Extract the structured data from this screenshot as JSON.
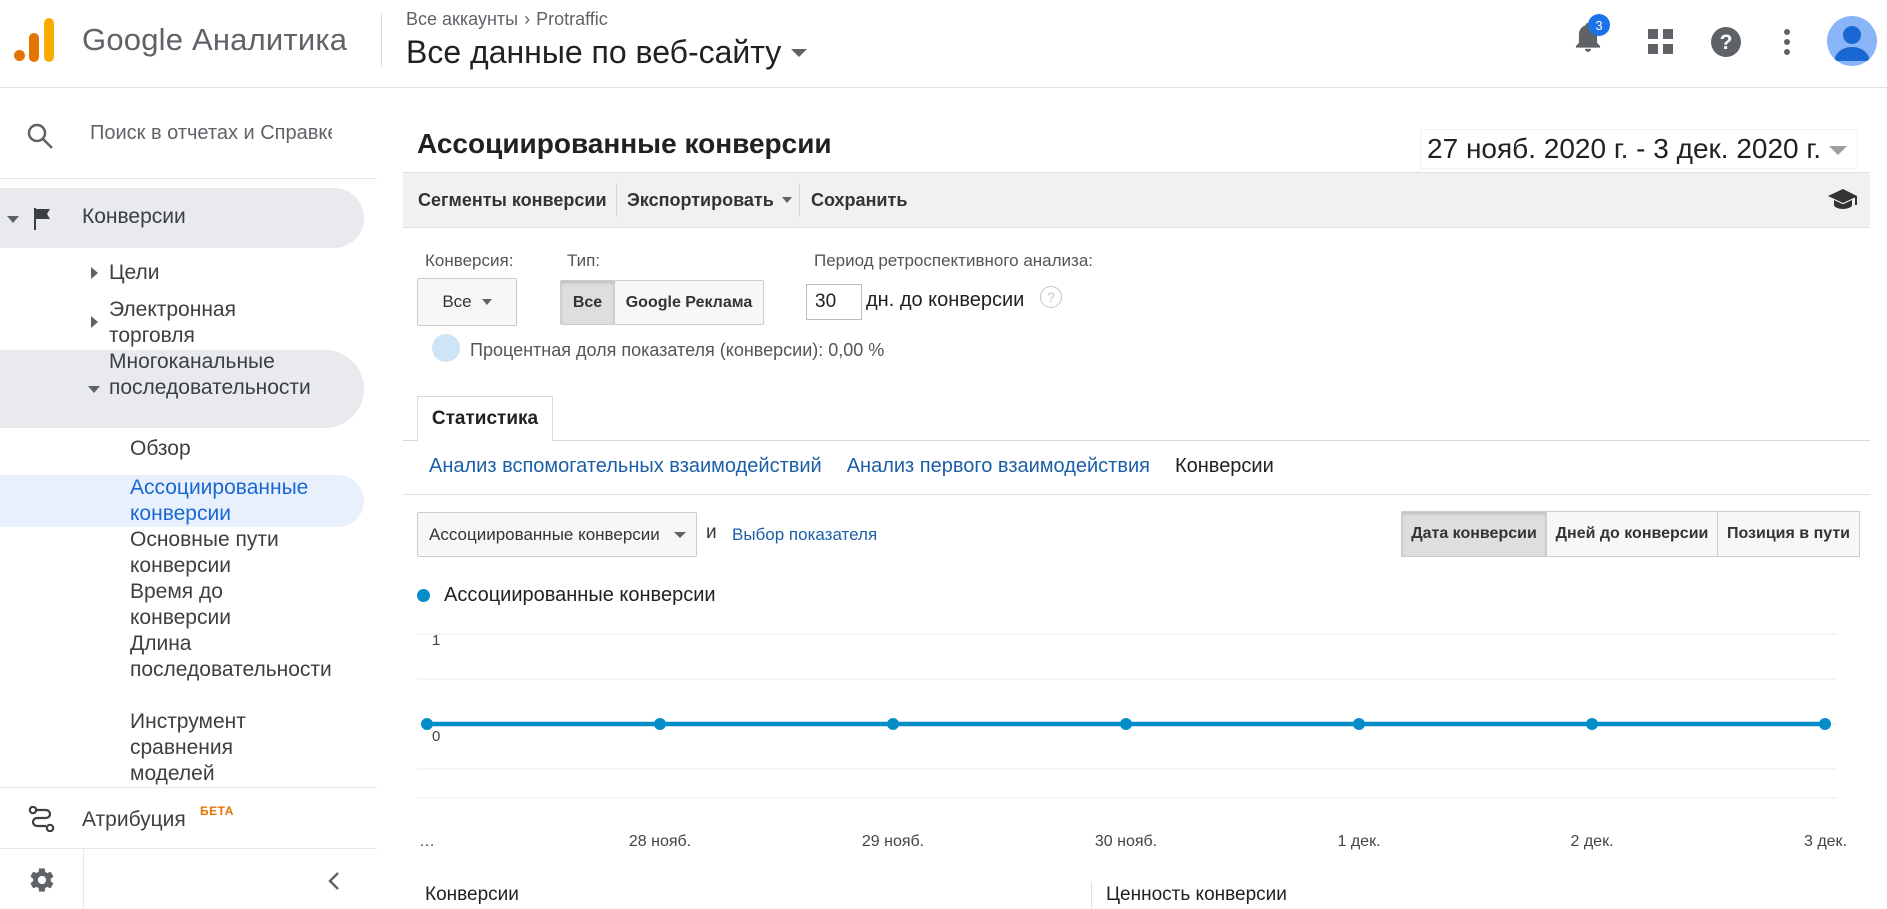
{
  "header": {
    "app_title": "Google Аналитика",
    "breadcrumb": {
      "root": "Все аккаунты",
      "sep": "›",
      "account": "Protraffic"
    },
    "view_title": "Все данные по веб-сайту",
    "notifications_count": "3",
    "icons": [
      "bell-icon",
      "apps-grid-icon",
      "help-icon",
      "more-vert-icon",
      "avatar"
    ]
  },
  "sidebar": {
    "search_placeholder": "Поиск в отчетах и Справке",
    "section": "Конверсии",
    "items": [
      {
        "label": "Цели"
      },
      {
        "label": "Электронная торговля"
      },
      {
        "label": "Многоканальные последовательности"
      }
    ],
    "mcf_items": [
      {
        "label": "Обзор"
      },
      {
        "label": "Ассоциированные конверсии"
      },
      {
        "label": "Основные пути конверсии"
      },
      {
        "label": "Время до конверсии"
      },
      {
        "label": "Длина последовательности"
      },
      {
        "label": "Инструмент сравнения моделей"
      }
    ],
    "attribution": "Атрибуция",
    "beta": "БЕТА"
  },
  "report": {
    "title": "Ассоциированные конверсии",
    "date_range": "27 нояб. 2020 г. - 3 дек. 2020 г.",
    "toolbar": {
      "segments": "Сегменты конверсии",
      "export": "Экспортировать",
      "save": "Сохранить"
    },
    "filters": {
      "conversion_label": "Конверсия:",
      "conversion_value": "Все",
      "type_label": "Тип:",
      "type_all": "Все",
      "type_ads": "Google Реклама",
      "lookback_label": "Период ретроспективного анализа:",
      "lookback_value": "30",
      "lookback_suffix": "дн. до конверсии",
      "help": "?",
      "pct_label": "Процентная доля показателя (конверсии): 0,00 %"
    },
    "tab": "Статистика",
    "subtabs": {
      "assisted": "Анализ вспомогательных взаимодействий",
      "first": "Анализ первого взаимодействия",
      "conversions": "Конверсии"
    },
    "metric_select": "Ассоциированные конверсии",
    "and_label": "и",
    "pick_metric": "Выбор показателя",
    "view_toggle": {
      "date": "Дата конверсии",
      "days": "Дней до конверсии",
      "position": "Позиция в пути"
    },
    "stats_headers": {
      "conversions": "Конверсии",
      "value": "Ценность конверсии"
    }
  },
  "chart_data": {
    "type": "line",
    "series": [
      {
        "name": "Ассоциированные конверсии",
        "values": [
          0,
          0,
          0,
          0,
          0,
          0,
          0
        ],
        "color": "#058dc7"
      }
    ],
    "categories": [
      "…",
      "28 нояб.",
      "29 нояб.",
      "30 нояб.",
      "1 дек.",
      "2 дек.",
      "3 дек."
    ],
    "ylim": [
      0,
      1
    ],
    "yticks": [
      "1",
      "0"
    ],
    "grid": true
  }
}
